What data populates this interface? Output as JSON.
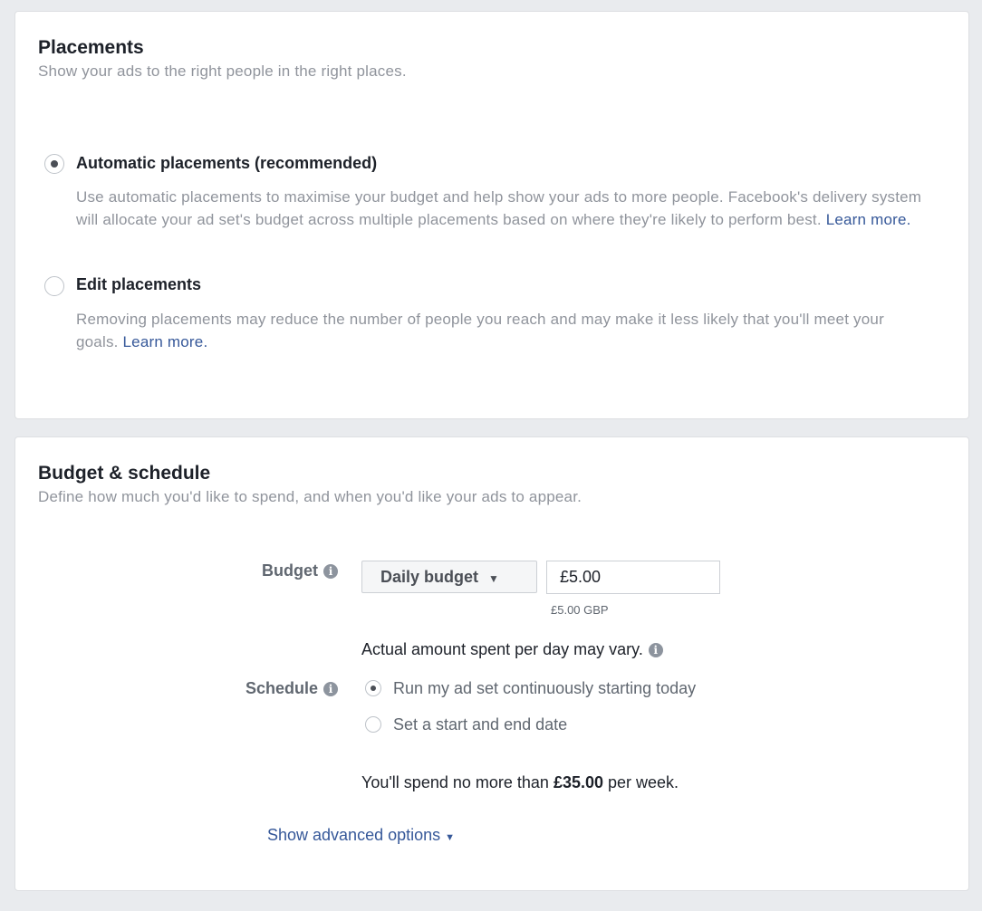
{
  "placements": {
    "title": "Placements",
    "subtitle": "Show your ads to the right people in the right places.",
    "options": [
      {
        "label": "Automatic placements (recommended)",
        "selected": true,
        "description": "Use automatic placements to maximise your budget and help show your ads to more people. Facebook's delivery system will allocate your ad set's budget across multiple placements based on where they're likely to perform best.",
        "link": "Learn more."
      },
      {
        "label": "Edit placements",
        "selected": false,
        "description": "Removing placements may reduce the number of people you reach and may make it less likely that you'll meet your goals.",
        "link": "Learn more."
      }
    ]
  },
  "budget": {
    "title": "Budget & schedule",
    "subtitle": "Define how much you'd like to spend, and when you'd like your ads to appear.",
    "budget_label": "Budget",
    "budget_type": "Daily budget",
    "amount": "£5.00",
    "amount_hint": "£5.00 GBP",
    "vary_note": "Actual amount spent per day may vary.",
    "schedule_label": "Schedule",
    "schedule_options": [
      {
        "label": "Run my ad set continuously starting today",
        "selected": true
      },
      {
        "label": "Set a start and end date",
        "selected": false
      }
    ],
    "spend_prefix": "You'll spend no more than",
    "spend_amount": "£35.00",
    "spend_suffix": "per week.",
    "advanced": "Show advanced options"
  },
  "icons": {
    "info": "info-icon",
    "dropdown": "caret-down-icon"
  }
}
